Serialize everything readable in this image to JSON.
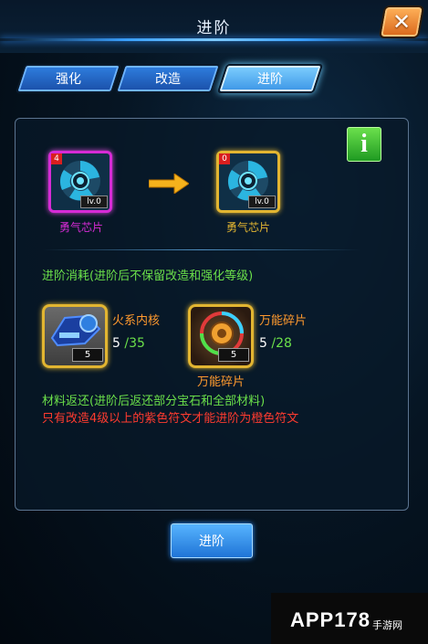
{
  "header": {
    "title": "进阶"
  },
  "tabs": [
    {
      "label": "强化",
      "active": false
    },
    {
      "label": "改造",
      "active": false
    },
    {
      "label": "进阶",
      "active": true
    }
  ],
  "upgrade": {
    "from": {
      "name": "勇气芯片",
      "count_badge": "4",
      "level": "lv.0",
      "border_color": "#d62bd6"
    },
    "to": {
      "name": "勇气芯片",
      "count_badge": "0",
      "level": "lv.0",
      "border_color": "#e2b531"
    }
  },
  "cost_heading": "进阶消耗(进阶后不保留改造和强化等级)",
  "materials": [
    {
      "name": "火系内核",
      "badge_qty": "5",
      "have": "5",
      "need": "/35",
      "icon": "fire-core-icon"
    },
    {
      "name": "万能碎片",
      "badge_qty": "5",
      "have": "5",
      "need": "/28",
      "icon": "universal-shard-icon",
      "caption": "万能碎片"
    }
  ],
  "return_note": "材料返还(进阶后返还部分宝石和全部材料)",
  "warning": "只有改造4级以上的紫色符文才能进阶为橙色符文",
  "advance_button": "进阶",
  "info_icon": "i",
  "watermark": {
    "logo": "APP178",
    "sub": "手游网"
  },
  "colors": {
    "accent_green": "#6be04a",
    "accent_orange": "#ff9a2e",
    "warning_red": "#ff3b2f",
    "rarity_purple": "#d62bd6",
    "rarity_gold": "#e2b531"
  }
}
